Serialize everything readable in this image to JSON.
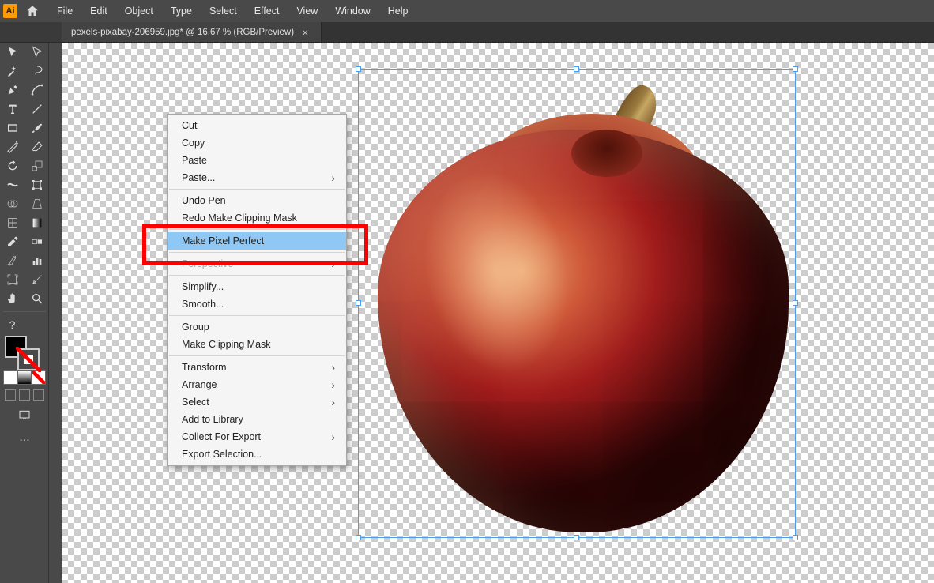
{
  "app": {
    "short": "Ai"
  },
  "menu": [
    "File",
    "Edit",
    "Object",
    "Type",
    "Select",
    "Effect",
    "View",
    "Window",
    "Help"
  ],
  "tab": {
    "title": "pexels-pixabay-206959.jpg* @ 16.67 % (RGB/Preview)"
  },
  "context_menu": {
    "items": [
      {
        "label": "Cut",
        "type": "item"
      },
      {
        "label": "Copy",
        "type": "item"
      },
      {
        "label": "Paste",
        "type": "item"
      },
      {
        "label": "Paste...",
        "type": "sub"
      },
      {
        "type": "sep"
      },
      {
        "label": "Undo Pen",
        "type": "item"
      },
      {
        "label": "Redo Make Clipping Mask",
        "type": "item"
      },
      {
        "type": "sep"
      },
      {
        "label": "Make Pixel Perfect",
        "type": "item",
        "hovered": true
      },
      {
        "type": "sep"
      },
      {
        "label": "Perspective",
        "type": "sub",
        "disabled": true
      },
      {
        "type": "sep"
      },
      {
        "label": "Simplify...",
        "type": "item"
      },
      {
        "label": "Smooth...",
        "type": "item"
      },
      {
        "type": "sep"
      },
      {
        "label": "Group",
        "type": "item"
      },
      {
        "label": "Make Clipping Mask",
        "type": "item"
      },
      {
        "type": "sep"
      },
      {
        "label": "Transform",
        "type": "sub"
      },
      {
        "label": "Arrange",
        "type": "sub"
      },
      {
        "label": "Select",
        "type": "sub"
      },
      {
        "label": "Add to Library",
        "type": "item"
      },
      {
        "label": "Collect For Export",
        "type": "sub"
      },
      {
        "label": "Export Selection...",
        "type": "item"
      }
    ]
  },
  "tools": [
    "selection",
    "direct-selection",
    "magic-wand",
    "lasso",
    "pen",
    "curvature",
    "type",
    "line",
    "rectangle",
    "paintbrush",
    "shaper",
    "eraser",
    "rotate",
    "scale",
    "width",
    "free-transform",
    "shape-builder",
    "perspective",
    "mesh",
    "gradient",
    "eyedropper",
    "blend",
    "symbol-sprayer",
    "column-graph",
    "artboard",
    "slice",
    "hand",
    "zoom"
  ],
  "tool_help": "?",
  "more": "..."
}
